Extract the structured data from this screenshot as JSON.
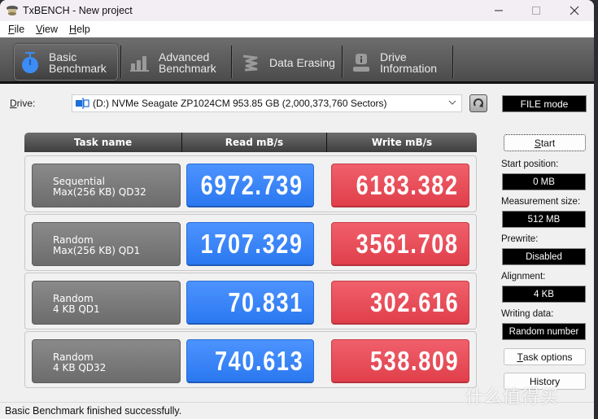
{
  "window": {
    "title": "TxBENCH - New project",
    "controls": {
      "minimize": "minimize",
      "maximize": "maximize",
      "close": "close"
    }
  },
  "menu": [
    {
      "label": "File",
      "accel": "F",
      "rest": "ile"
    },
    {
      "label": "View",
      "accel": "V",
      "rest": "iew"
    },
    {
      "label": "Help",
      "accel": "H",
      "rest": "elp"
    }
  ],
  "tabs": [
    {
      "line1": "Basic",
      "line2": "Benchmark",
      "icon": "stopwatch-icon",
      "active": true
    },
    {
      "line1": "Advanced",
      "line2": "Benchmark",
      "icon": "bar-chart-icon",
      "active": false
    },
    {
      "line1": "Data Erasing",
      "line2": "",
      "icon": "eraser-icon",
      "active": false
    },
    {
      "line1": "Drive",
      "line2": "Information",
      "icon": "drive-info-icon",
      "active": false
    }
  ],
  "drive": {
    "label_accel": "D",
    "label_rest": "rive:",
    "selected": "(D:) NVMe Seagate ZP1024CM  953.85 GB (2,000,373,760 Sectors)"
  },
  "mode": "FILE mode",
  "results": {
    "headers": {
      "task": "Task name",
      "read": "Read mB/s",
      "write": "Write mB/s"
    },
    "rows": [
      {
        "line1": "Sequential",
        "line2": "Max(256 KB) QD32",
        "read": "6972.739",
        "write": "6183.382"
      },
      {
        "line1": "Random",
        "line2": "Max(256 KB) QD1",
        "read": "1707.329",
        "write": "3561.708"
      },
      {
        "line1": "Random",
        "line2": "4 KB QD1",
        "read": "70.831",
        "write": "302.616"
      },
      {
        "line1": "Random",
        "line2": "4 KB QD32",
        "read": "740.613",
        "write": "538.809"
      }
    ]
  },
  "side": {
    "start": {
      "accel": "S",
      "rest": "tart"
    },
    "start_position_label": "Start position:",
    "start_position": "0 MB",
    "measurement_size_label": "Measurement size:",
    "measurement_size": "512 MB",
    "prewrite_label": "Prewrite:",
    "prewrite": "Disabled",
    "alignment_label": "Alignment:",
    "alignment": "4 KB",
    "writing_data_label": "Writing data:",
    "writing_data": "Random number",
    "task_options": {
      "accel": "T",
      "rest": "ask options"
    },
    "history": "History"
  },
  "status": "Basic Benchmark finished successfully.",
  "watermark": "什么值得买",
  "colors": {
    "read": "#2f7ff5",
    "write": "#e84853",
    "task": "#7a7a7a"
  }
}
